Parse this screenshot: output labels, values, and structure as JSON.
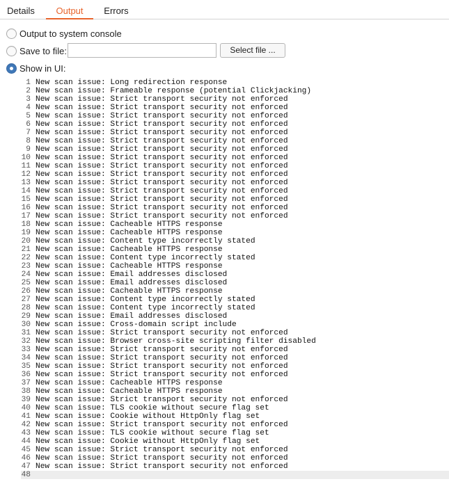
{
  "tabs": [
    {
      "label": "Details",
      "active": false
    },
    {
      "label": "Output",
      "active": true
    },
    {
      "label": "Errors",
      "active": false
    }
  ],
  "colors": {
    "accent": "#e8632b",
    "radio_selected": "#3f78b8"
  },
  "output_options": {
    "console_label": "Output to system console",
    "file_label": "Save to file:",
    "file_value": "",
    "select_file_label": "Select file ...",
    "ui_label": "Show in UI:",
    "selected": "ui"
  },
  "console": {
    "lines": [
      "New scan issue: Long redirection response",
      "New scan issue: Frameable response (potential Clickjacking)",
      "New scan issue: Strict transport security not enforced",
      "New scan issue: Strict transport security not enforced",
      "New scan issue: Strict transport security not enforced",
      "New scan issue: Strict transport security not enforced",
      "New scan issue: Strict transport security not enforced",
      "New scan issue: Strict transport security not enforced",
      "New scan issue: Strict transport security not enforced",
      "New scan issue: Strict transport security not enforced",
      "New scan issue: Strict transport security not enforced",
      "New scan issue: Strict transport security not enforced",
      "New scan issue: Strict transport security not enforced",
      "New scan issue: Strict transport security not enforced",
      "New scan issue: Strict transport security not enforced",
      "New scan issue: Strict transport security not enforced",
      "New scan issue: Strict transport security not enforced",
      "New scan issue: Cacheable HTTPS response",
      "New scan issue: Cacheable HTTPS response",
      "New scan issue: Content type incorrectly stated",
      "New scan issue: Cacheable HTTPS response",
      "New scan issue: Content type incorrectly stated",
      "New scan issue: Cacheable HTTPS response",
      "New scan issue: Email addresses disclosed",
      "New scan issue: Email addresses disclosed",
      "New scan issue: Cacheable HTTPS response",
      "New scan issue: Content type incorrectly stated",
      "New scan issue: Content type incorrectly stated",
      "New scan issue: Email addresses disclosed",
      "New scan issue: Cross-domain script include",
      "New scan issue: Strict transport security not enforced",
      "New scan issue: Browser cross-site scripting filter disabled",
      "New scan issue: Strict transport security not enforced",
      "New scan issue: Strict transport security not enforced",
      "New scan issue: Strict transport security not enforced",
      "New scan issue: Strict transport security not enforced",
      "New scan issue: Cacheable HTTPS response",
      "New scan issue: Cacheable HTTPS response",
      "New scan issue: Strict transport security not enforced",
      "New scan issue: TLS cookie without secure flag set",
      "New scan issue: Cookie without HttpOnly flag set",
      "New scan issue: Strict transport security not enforced",
      "New scan issue: TLS cookie without secure flag set",
      "New scan issue: Cookie without HttpOnly flag set",
      "New scan issue: Strict transport security not enforced",
      "New scan issue: Strict transport security not enforced",
      "New scan issue: Strict transport security not enforced",
      ""
    ]
  }
}
